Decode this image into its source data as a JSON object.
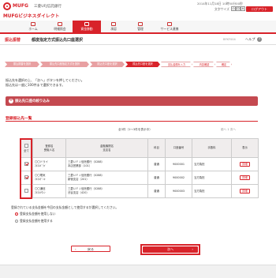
{
  "header": {
    "brand": "MUFG",
    "bank_name": "三菱UFJ信託銀行",
    "sub_brand": "MUFGビジネスダイレクト",
    "datetime": "2014年11月18日 10時50分00秒",
    "font_size_label": "文字サイズ",
    "font_sizes": [
      "小",
      "中",
      "大"
    ],
    "logout_label": "ログアウト"
  },
  "nav": {
    "items": [
      {
        "label": "ホーム",
        "icon": "home-icon"
      },
      {
        "label": "明細照会",
        "icon": "statement-icon"
      },
      {
        "label": "資金移動",
        "icon": "transfer-icon",
        "active": true
      },
      {
        "label": "承認",
        "icon": "approval-icon"
      },
      {
        "label": "管理",
        "icon": "admin-icon"
      },
      {
        "label": "サービス連携",
        "icon": "service-icon"
      }
    ],
    "accent": "#d8232a"
  },
  "page": {
    "section": "振込振替",
    "title": "都度指定方式振込先口座選択",
    "screen_id": "BFKF004",
    "help": "ヘルプ"
  },
  "steps": [
    "振込振替を選択",
    "振込先口座指定方式を選択",
    "振込先口座を選択",
    "振込先口座を選択",
    "支払金額を入力",
    "内容確認",
    "確定"
  ],
  "instructions": {
    "line1": "振込先を選択の上、「次へ」ボタンを押してください。",
    "line2": "振込先は一度に100件まで選択できます。"
  },
  "filter": {
    "toggle_icon": "+",
    "title": "振込先口座の絞り込み"
  },
  "list": {
    "title": "登録振込先一覧",
    "result_count": "全3件（1〜3件を表示中）",
    "pager": "前へ  1  次へ",
    "columns": {
      "select_all": "全て",
      "name": "登録名\n受取人名",
      "bank": "金融機関名\n支店名",
      "type": "科目",
      "account": "口座番号",
      "fee": "手数料",
      "view": "表示"
    },
    "rows": [
      {
        "checked": true,
        "name1": "〇〇ドライ",
        "name2": "ﾏﾙﾏﾙﾄﾞﾗｲ",
        "bank1": "三菱ＵＦＪ信託銀行（0288）",
        "bank2": "本店営業部（101）",
        "type": "普通",
        "account": "9000001",
        "fee": "当方負担",
        "detail": "詳細"
      },
      {
        "checked": true,
        "name1": "〇〇電気",
        "name2": "ﾏﾙﾏﾙﾃﾞﾝｷ",
        "bank1": "三菱ＵＦＪ信託銀行（0288）",
        "bank2": "新宿支店（201）",
        "type": "普通",
        "account": "9000002",
        "fee": "当方負担",
        "detail": "詳細"
      },
      {
        "checked": false,
        "name1": "〇〇通信",
        "name2": "ﾏﾙﾏﾙﾂｳｼﾝ",
        "bank1": "三菱ＵＦＪ信託銀行（0288）",
        "bank2": "渋谷支店（420）",
        "type": "普通",
        "account": "9000003",
        "fee": "当方負担",
        "detail": "詳細"
      }
    ]
  },
  "representative": {
    "question": "登録されている支払金額を今回の支払金額として使用するか選択してください。",
    "options": [
      {
        "label": "登録支払金額を使用しない",
        "selected": true
      },
      {
        "label": "登録支払金額を使用する",
        "selected": false
      }
    ]
  },
  "buttons": {
    "back": "戻る",
    "next": "次へ"
  }
}
